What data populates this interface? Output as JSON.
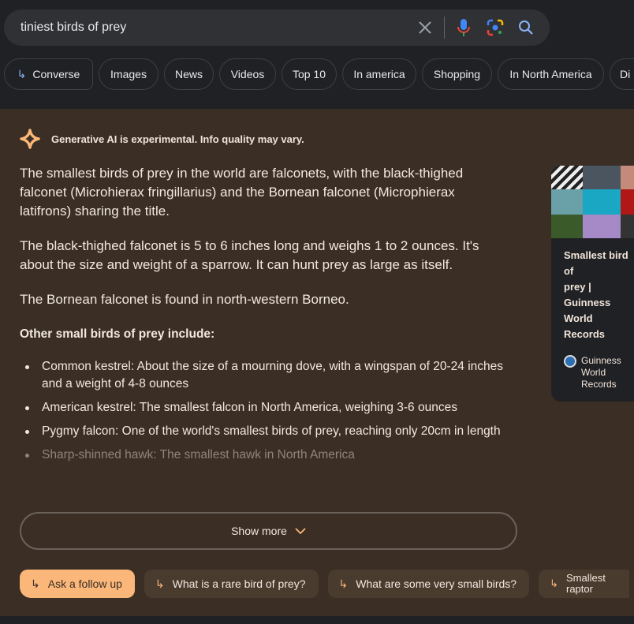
{
  "search": {
    "query": "tiniest birds of prey"
  },
  "chips": [
    "Converse",
    "Images",
    "News",
    "Videos",
    "Top 10",
    "In america",
    "Shopping",
    "In North America",
    "Di"
  ],
  "ai": {
    "disclaimer": "Generative AI is experimental. Info quality may vary.",
    "paragraphs": [
      "The smallest birds of prey in the world are falconets, with the black-thighed falconet (Microhierax fringillarius) and the Bornean falconet (Microphierax latifrons) sharing the title.",
      "The black-thighed falconet is 5 to 6 inches long and weighs 1 to 2 ounces. It's about the size and weight of a sparrow. It can hunt prey as large as itself.",
      "The Bornean falconet is found in north-western Borneo."
    ],
    "subheading": "Other small birds of prey include:",
    "bullets": [
      "Common kestrel: About the size of a mourning dove, with a wingspan of 20-24 inches and a weight of 4-8 ounces",
      "American kestrel: The smallest falcon in North America, weighing 3-6 ounces",
      "Pygmy falcon: One of the world's smallest birds of prey, reaching only 20cm in length",
      "Sharp-shinned hawk: The smallest hawk in North America"
    ],
    "show_more": "Show more",
    "source_card": {
      "title_lines": [
        "Smallest bird of",
        "prey | Guinness",
        "World Records"
      ],
      "source": "Guinness World Records"
    },
    "followups": [
      "Ask a follow up",
      "What is a rare bird of prey?",
      "What are some very small birds?",
      "Smallest raptor"
    ]
  },
  "colors": {
    "accent": "#fbb77a",
    "panel": "#3a2e25",
    "page": "#202124"
  }
}
